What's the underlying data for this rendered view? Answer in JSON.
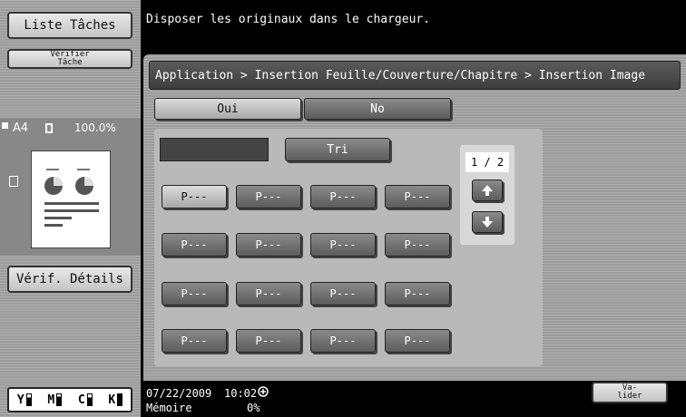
{
  "sidebar": {
    "job_list_label": "Liste Tâches",
    "check_job_label": "Vérifier Tâche",
    "paper_size": "A4",
    "zoom": "100.0%",
    "check_details_label": "Vérif. Détails"
  },
  "toner": {
    "levels": [
      "Y",
      "M",
      "C",
      "K"
    ]
  },
  "message": "Disposer les originaux dans le chargeur.",
  "breadcrumb": "Application > Insertion Feuille/Couverture/Chapitre > Insertion Image",
  "toggle": {
    "yes_label": "Oui",
    "no_label": "No"
  },
  "sort_label": "Tri",
  "pager": {
    "indicator": "1 / 2"
  },
  "page_buttons": [
    "P---",
    "P---",
    "P---",
    "P---",
    "P---",
    "P---",
    "P---",
    "P---",
    "P---",
    "P---",
    "P---",
    "P---",
    "P---",
    "P---",
    "P---",
    "P---"
  ],
  "status": {
    "date": "07/22/2009",
    "time": "10:02",
    "memory_label": "Mémoire",
    "memory_value": "0%"
  },
  "validate_label": "Va-\nlider"
}
